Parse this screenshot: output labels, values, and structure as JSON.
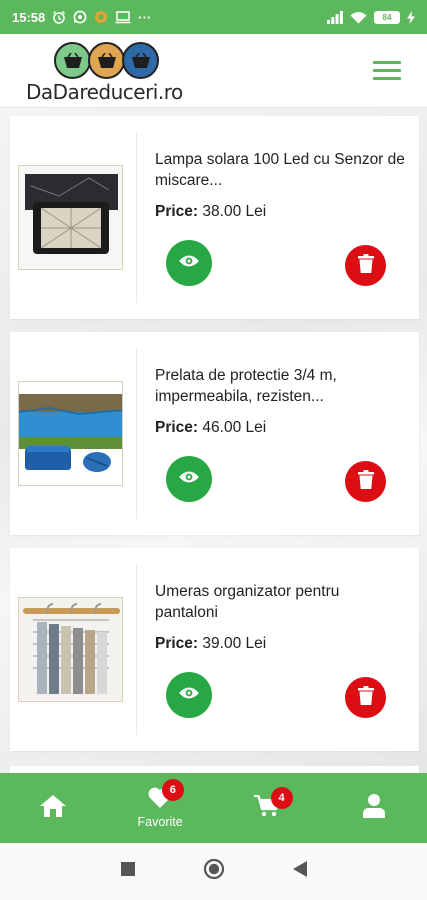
{
  "status_bar": {
    "time": "15:58",
    "battery": "84",
    "more": "···"
  },
  "header": {
    "logo_text": "DaDareduceri.ro"
  },
  "products": [
    {
      "title": "Lampa solara 100 Led cu Senzor de miscare...",
      "price_label": "Price:",
      "price_value": "38.00 Lei"
    },
    {
      "title": "Prelata de protectie 3/4 m, impermeabila, rezisten...",
      "price_label": "Price:",
      "price_value": "46.00 Lei"
    },
    {
      "title": "Umeras organizator pentru pantaloni",
      "price_label": "Price:",
      "price_value": "39.00 Lei"
    }
  ],
  "bottom_nav": {
    "favorites_label": "Favorite",
    "favorites_count": "6",
    "cart_count": "4"
  },
  "colors": {
    "brand_green": "#5cb85c",
    "view_green": "#28a745",
    "delete_red": "#dc0e14"
  }
}
